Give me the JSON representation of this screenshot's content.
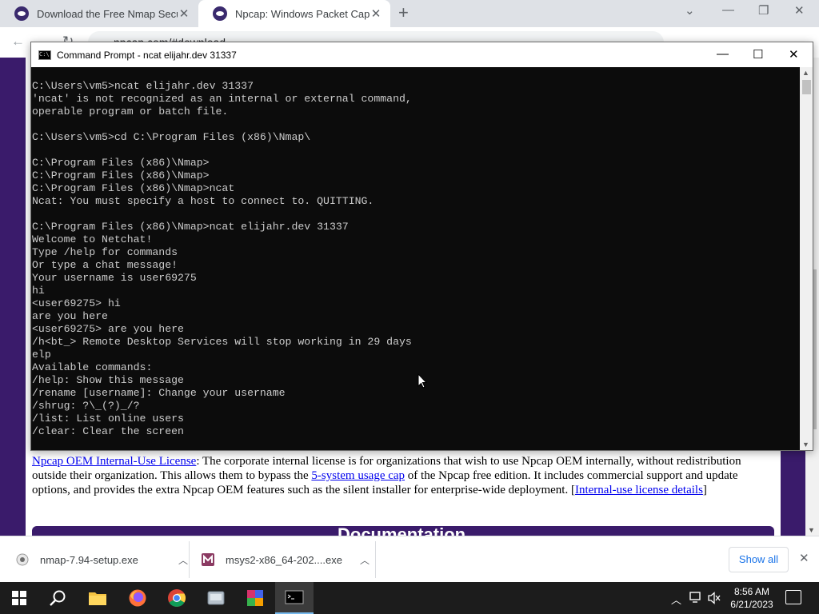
{
  "browser": {
    "tabs": [
      {
        "title": "Download the Free Nmap Securi",
        "close": "✕",
        "active": false
      },
      {
        "title": "Npcap: Windows Packet Capture",
        "close": "✕",
        "active": true
      }
    ],
    "new_tab": "+",
    "url": "npcap.com/#download"
  },
  "webpage": {
    "license_link": "Npcap OEM Internal-Use License",
    "license_text_1": ": The corporate internal license is for organizations that wish to use Npcap OEM internally, without redistribution outside their organization. This allows them to bypass the ",
    "usage_cap_link": "5-system usage cap",
    "license_text_2": " of the Npcap free edition. It includes commercial support and update options, and provides the extra Npcap OEM features such as the silent installer for enterprise-wide deployment. [",
    "details_link": "Internal-use license details",
    "license_text_3": "]",
    "section_heading": "Documentation"
  },
  "cmd": {
    "title": "Command Prompt - ncat  elijahr.dev 31337",
    "lines": [
      "C:\\Users\\vm5>ncat elijahr.dev 31337",
      "'ncat' is not recognized as an internal or external command,",
      "operable program or batch file.",
      "",
      "C:\\Users\\vm5>cd C:\\Program Files (x86)\\Nmap\\",
      "",
      "C:\\Program Files (x86)\\Nmap>",
      "C:\\Program Files (x86)\\Nmap>",
      "C:\\Program Files (x86)\\Nmap>ncat",
      "Ncat: You must specify a host to connect to. QUITTING.",
      "",
      "C:\\Program Files (x86)\\Nmap>ncat elijahr.dev 31337",
      "Welcome to Netchat!",
      "Type /help for commands",
      "Or type a chat message!",
      "Your username is user69275",
      "hi",
      "<user69275> hi",
      "are you here",
      "<user69275> are you here",
      "/h<bt_> Remote Desktop Services will stop working in 29 days",
      "elp",
      "Available commands:",
      "/help: Show this message",
      "/rename [username]: Change your username",
      "/shrug: ?\\_(?)_/?",
      "/list: List online users",
      "/clear: Clear the screen"
    ]
  },
  "downloads": [
    {
      "name": "nmap-7.94-setup.exe",
      "icon": "installer-icon"
    },
    {
      "name": "msys2-x86_64-202....exe",
      "icon": "msys2-icon"
    }
  ],
  "download_shelf": {
    "show_all": "Show all",
    "close": "✕"
  },
  "taskbar": {
    "time": "8:56 AM",
    "date": "6/21/2023",
    "apps": [
      "start",
      "search",
      "file-explorer",
      "firefox",
      "chrome",
      "nmap-installer",
      "winrar",
      "command-prompt"
    ]
  },
  "colors": {
    "accent": "#3a1b6b",
    "link": "#0000ee",
    "console_bg": "#0c0c0c",
    "console_fg": "#cccccc"
  }
}
